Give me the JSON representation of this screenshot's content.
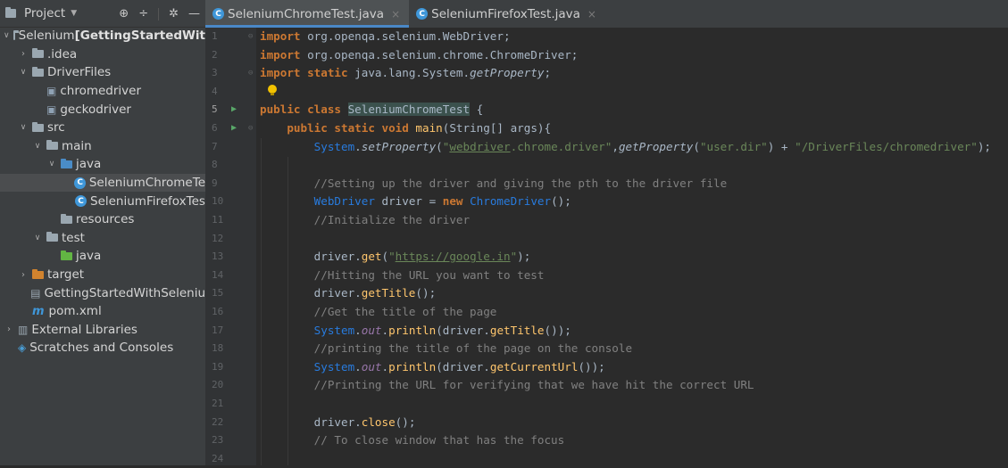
{
  "project_panel": {
    "title": "Project",
    "tree": [
      {
        "label": "Selenium",
        "suffix": " [GettingStartedWit",
        "level": 0,
        "expanded": true,
        "icon": "module-folder-icon"
      },
      {
        "label": ".idea",
        "level": 1,
        "expanded": false,
        "icon": "folder-icon"
      },
      {
        "label": "DriverFiles",
        "level": 1,
        "expanded": true,
        "icon": "folder-icon"
      },
      {
        "label": "chromedriver",
        "level": 2,
        "icon": "binary-file-icon"
      },
      {
        "label": "geckodriver",
        "level": 2,
        "icon": "binary-file-icon"
      },
      {
        "label": "src",
        "level": 1,
        "expanded": true,
        "icon": "folder-icon"
      },
      {
        "label": "main",
        "level": 2,
        "expanded": true,
        "icon": "folder-icon"
      },
      {
        "label": "java",
        "level": 3,
        "expanded": true,
        "icon": "source-folder-icon"
      },
      {
        "label": "SeleniumChromeTe",
        "level": 4,
        "icon": "java-class-icon",
        "selected": true
      },
      {
        "label": "SeleniumFirefoxTes",
        "level": 4,
        "icon": "java-class-icon"
      },
      {
        "label": "resources",
        "level": 3,
        "icon": "resources-folder-icon"
      },
      {
        "label": "test",
        "level": 2,
        "expanded": true,
        "icon": "folder-icon"
      },
      {
        "label": "java",
        "level": 3,
        "icon": "test-folder-icon"
      },
      {
        "label": "target",
        "level": 1,
        "expanded": false,
        "icon": "excluded-folder-icon"
      },
      {
        "label": "GettingStartedWithSeleniu",
        "level": 1,
        "icon": "iml-file-icon"
      },
      {
        "label": "pom.xml",
        "level": 1,
        "icon": "maven-icon"
      },
      {
        "label": "External Libraries",
        "level": 0,
        "expanded": false,
        "icon": "libraries-icon"
      },
      {
        "label": "Scratches and Consoles",
        "level": 0,
        "icon": "scratches-icon"
      }
    ]
  },
  "tabs": [
    {
      "label": "SeleniumChromeTest.java",
      "active": true
    },
    {
      "label": "SeleniumFirefoxTest.java",
      "active": false
    }
  ],
  "editor": {
    "lines": [
      {
        "n": "1",
        "code": [
          [
            "kw",
            "import"
          ],
          [
            "plain",
            " org.openqa.selenium.WebDriver;"
          ]
        ]
      },
      {
        "n": "2",
        "code": [
          [
            "kw",
            "import"
          ],
          [
            "plain",
            " org.openqa.selenium.chrome.ChromeDriver;"
          ]
        ]
      },
      {
        "n": "3",
        "code": [
          [
            "kw",
            "import static"
          ],
          [
            "plain",
            " java.lang.System."
          ],
          [
            "it",
            "getProperty"
          ],
          [
            "plain",
            ";"
          ]
        ]
      },
      {
        "n": "4",
        "code": []
      },
      {
        "n": "5",
        "code": [
          [
            "kw",
            "public class "
          ],
          [
            "hl",
            "SeleniumChromeTest"
          ],
          [
            "plain",
            " {"
          ]
        ],
        "run": true
      },
      {
        "n": "6",
        "code": [
          [
            "plain",
            "    "
          ],
          [
            "kw",
            "public static void "
          ],
          [
            "fnc",
            "main"
          ],
          [
            "plain",
            "(String[] args){"
          ]
        ],
        "run": true
      },
      {
        "n": "7",
        "code": [
          [
            "plain",
            "        "
          ],
          [
            "cls",
            "System"
          ],
          [
            "plain",
            "."
          ],
          [
            "it",
            "setProperty"
          ],
          [
            "plain",
            "("
          ],
          [
            "str",
            "\""
          ],
          [
            "url",
            "webdriver"
          ],
          [
            "str",
            ".chrome.driver\""
          ],
          [
            "plain",
            ","
          ],
          [
            "it",
            "getProperty"
          ],
          [
            "plain",
            "("
          ],
          [
            "str",
            "\"user.dir\""
          ],
          [
            "plain",
            ") + "
          ],
          [
            "str",
            "\"/DriverFiles/chromedriver\""
          ],
          [
            "plain",
            ");"
          ]
        ]
      },
      {
        "n": "8",
        "code": []
      },
      {
        "n": "9",
        "code": [
          [
            "plain",
            "        "
          ],
          [
            "cmt",
            "//Setting up the driver and giving the pth to the driver file"
          ]
        ]
      },
      {
        "n": "10",
        "code": [
          [
            "plain",
            "        "
          ],
          [
            "cls",
            "WebDriver"
          ],
          [
            "plain",
            " driver = "
          ],
          [
            "kw",
            "new "
          ],
          [
            "cls",
            "ChromeDriver"
          ],
          [
            "plain",
            "();"
          ]
        ]
      },
      {
        "n": "11",
        "code": [
          [
            "plain",
            "        "
          ],
          [
            "cmt",
            "//Initialize the driver"
          ]
        ]
      },
      {
        "n": "12",
        "code": []
      },
      {
        "n": "13",
        "code": [
          [
            "plain",
            "        driver."
          ],
          [
            "meth",
            "get"
          ],
          [
            "plain",
            "("
          ],
          [
            "str",
            "\""
          ],
          [
            "url",
            "https://google.in"
          ],
          [
            "str",
            "\""
          ],
          [
            "plain",
            ");"
          ]
        ]
      },
      {
        "n": "14",
        "code": [
          [
            "plain",
            "        "
          ],
          [
            "cmt",
            "//Hitting the URL you want to test"
          ]
        ]
      },
      {
        "n": "15",
        "code": [
          [
            "plain",
            "        driver."
          ],
          [
            "meth",
            "getTitle"
          ],
          [
            "plain",
            "();"
          ]
        ]
      },
      {
        "n": "16",
        "code": [
          [
            "plain",
            "        "
          ],
          [
            "cmt",
            "//Get the title of the page"
          ]
        ]
      },
      {
        "n": "17",
        "code": [
          [
            "plain",
            "        "
          ],
          [
            "cls",
            "System"
          ],
          [
            "plain",
            "."
          ],
          [
            "var",
            "out"
          ],
          [
            "plain",
            "."
          ],
          [
            "meth",
            "println"
          ],
          [
            "plain",
            "(driver."
          ],
          [
            "meth",
            "getTitle"
          ],
          [
            "plain",
            "());"
          ]
        ]
      },
      {
        "n": "18",
        "code": [
          [
            "plain",
            "        "
          ],
          [
            "cmt",
            "//printing the title of the page on the console"
          ]
        ]
      },
      {
        "n": "19",
        "code": [
          [
            "plain",
            "        "
          ],
          [
            "cls",
            "System"
          ],
          [
            "plain",
            "."
          ],
          [
            "var",
            "out"
          ],
          [
            "plain",
            "."
          ],
          [
            "meth",
            "println"
          ],
          [
            "plain",
            "(driver."
          ],
          [
            "meth",
            "getCurrentUrl"
          ],
          [
            "plain",
            "());"
          ]
        ]
      },
      {
        "n": "20",
        "code": [
          [
            "plain",
            "        "
          ],
          [
            "cmt",
            "//Printing the URL for verifying that we have hit the correct URL"
          ]
        ]
      },
      {
        "n": "21",
        "code": []
      },
      {
        "n": "22",
        "code": [
          [
            "plain",
            "        driver."
          ],
          [
            "meth",
            "close"
          ],
          [
            "plain",
            "();"
          ]
        ]
      },
      {
        "n": "23",
        "code": [
          [
            "plain",
            "        "
          ],
          [
            "cmt",
            "// To close window that has the focus"
          ]
        ]
      },
      {
        "n": "24",
        "code": []
      }
    ]
  },
  "colors": {
    "keyword": "#cc7832",
    "string": "#6a8759",
    "comment": "#808080",
    "class": "#287bde",
    "method": "#ffc66d",
    "accent": "#4a88c7"
  }
}
